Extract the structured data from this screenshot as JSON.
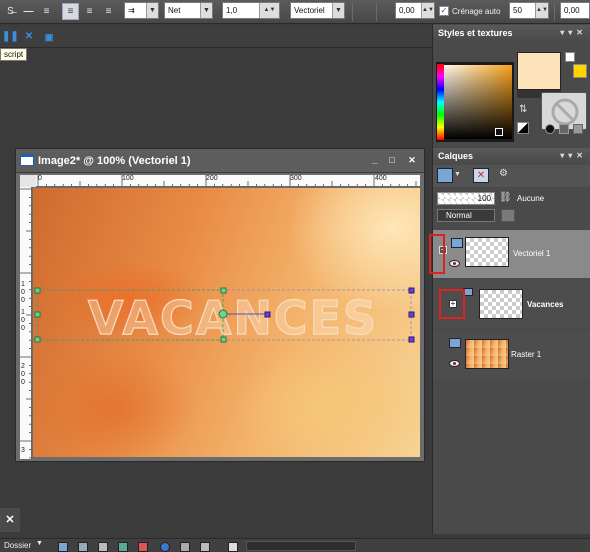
{
  "toolbar": {
    "line_style": "Net",
    "width_value": "1,0",
    "create_as": "Vectoriel",
    "kerning_value": "0,00",
    "leading_value": "0,00",
    "auto_kerning_label": "Crénage auto",
    "auto_kerning_checked": true,
    "opacity_value": "50"
  },
  "scriptbar": {
    "tooltip": "script"
  },
  "image_window": {
    "title": "Image2* @ 100% (Vectoriel 1)",
    "canvas_text": "VACANCES",
    "ruler_top": [
      "0",
      "100",
      "200",
      "300",
      "400"
    ],
    "ruler_left": [
      "1",
      "0",
      "0",
      "1",
      "0",
      "0",
      "2",
      "0",
      "0",
      "3"
    ]
  },
  "styles_panel": {
    "title": "Styles et textures",
    "foreground_color": "#fde3b9",
    "accent_color": "#fde3b9"
  },
  "layers_panel": {
    "title": "Calques",
    "opacity_value": "100",
    "mask_label": "Aucune",
    "blend_mode": "Normal",
    "layers": [
      {
        "name": "Vectoriel 1",
        "expand": "−"
      },
      {
        "name": "Vacances",
        "expand": "+"
      },
      {
        "name": "Raster 1"
      }
    ]
  },
  "statusbar": {
    "folder_label": "Dossier"
  }
}
